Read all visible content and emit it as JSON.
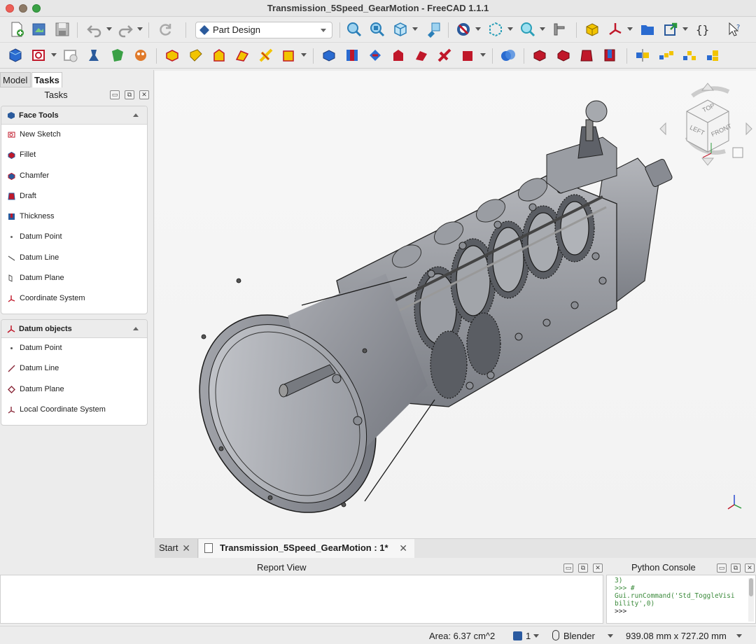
{
  "window": {
    "title": "Transmission_5Speed_GearMotion - FreeCAD 1.1.1"
  },
  "toolbar": {
    "workbench": "Part Design"
  },
  "left_panel": {
    "tabs": [
      {
        "label": "Model"
      },
      {
        "label": "Tasks"
      }
    ],
    "title": "Tasks",
    "face_tools": {
      "heading": "Face Tools",
      "items": [
        {
          "label": "New Sketch",
          "icon": "sketch-icon"
        },
        {
          "label": "Fillet",
          "icon": "fillet-icon"
        },
        {
          "label": "Chamfer",
          "icon": "chamfer-icon"
        },
        {
          "label": "Draft",
          "icon": "draft-icon"
        },
        {
          "label": "Thickness",
          "icon": "thickness-icon"
        },
        {
          "label": "Datum Point",
          "icon": "datum-point-icon"
        },
        {
          "label": "Datum Line",
          "icon": "datum-line-icon"
        },
        {
          "label": "Datum Plane",
          "icon": "datum-plane-icon"
        },
        {
          "label": "Coordinate System",
          "icon": "coordinate-system-icon"
        }
      ]
    },
    "datum_objects": {
      "heading": "Datum objects",
      "items": [
        {
          "label": "Datum Point",
          "icon": "datum-point-icon"
        },
        {
          "label": "Datum Line",
          "icon": "datum-line-icon"
        },
        {
          "label": "Datum Plane",
          "icon": "datum-plane-icon"
        },
        {
          "label": "Local Coordinate System",
          "icon": "local-coordinate-system-icon"
        }
      ]
    }
  },
  "navcube": {
    "top": "TOP",
    "left": "LEFT",
    "front": "FRONT"
  },
  "doc_tabs": [
    {
      "label": "Start",
      "close": "✕"
    },
    {
      "label": "Transmission_5Speed_GearMotion : 1*",
      "close": "✕"
    }
  ],
  "report_view": {
    "title": "Report View"
  },
  "python_console": {
    "title": "Python Console",
    "lines": [
      "3)",
      ">>> #",
      "Gui.runCommand('Std_ToggleVisi",
      "bility',0)",
      ">>>"
    ]
  },
  "status": {
    "area": "Area: 6.37 cm^2",
    "page": "1",
    "nav_style": "Blender",
    "dimensions": "939.08 mm x 727.20 mm"
  },
  "colors": {
    "accent_blue": "#2a5a9c",
    "feature_red": "#c0182a",
    "feature_yellow": "#f2c400",
    "background_top": "#f7f7f7"
  }
}
